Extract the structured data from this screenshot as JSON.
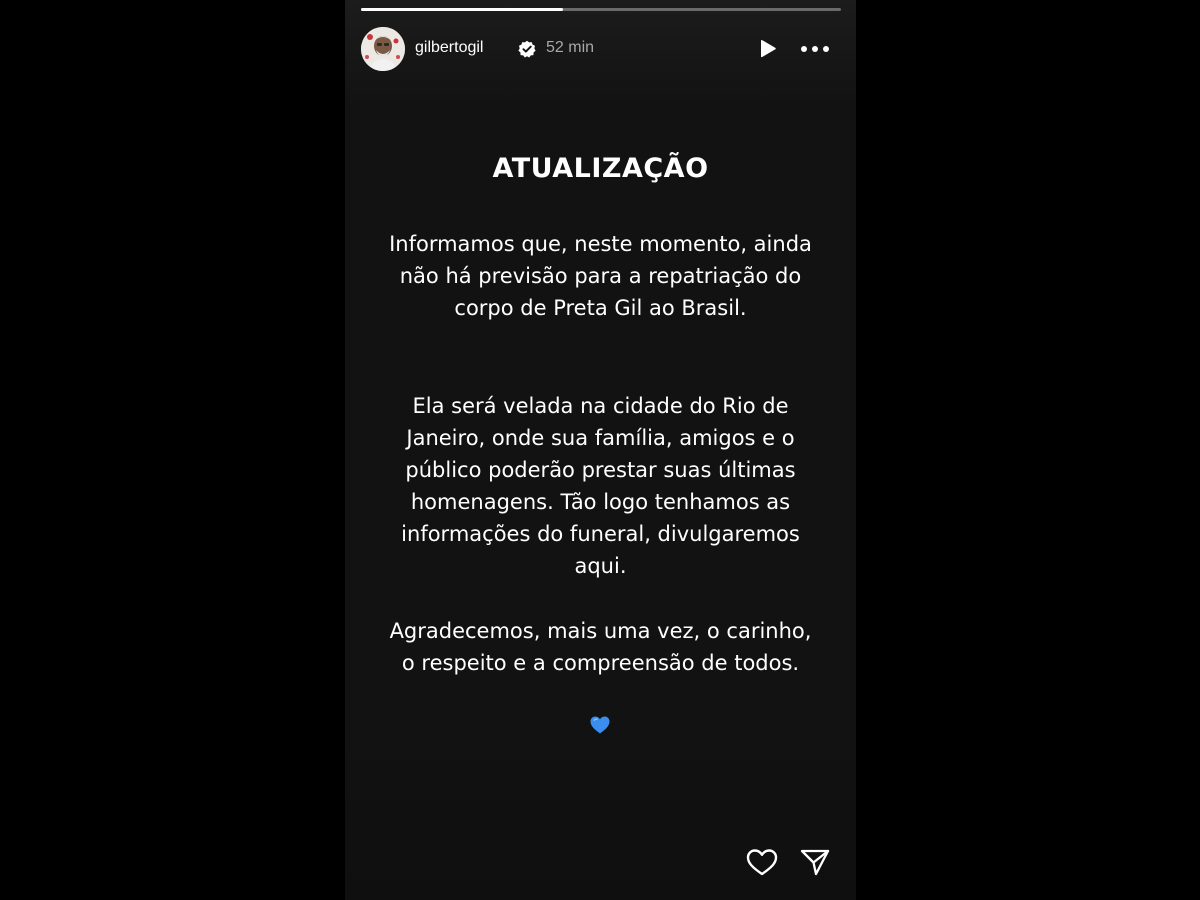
{
  "story": {
    "progress": 0.42,
    "user": {
      "username": "gilbertogil",
      "verified": true,
      "time_ago": "52 min"
    },
    "controls": {
      "play_icon": "play-icon",
      "more_icon": "more-horizontal-icon"
    },
    "post": {
      "title": "ATUALIZAÇÃO",
      "paragraph_1": "Informamos que, neste momento, ainda não há previsão para a repatriação do corpo de Preta Gil ao Brasil.",
      "paragraph_2": "Ela será velada na cidade do Rio de Janeiro, onde sua família, amigos e o público poderão prestar suas últimas homenagens. Tão logo tenhamos as informações do funeral, divulgaremos aqui.",
      "paragraph_3": "Agradecemos, mais uma vez, o carinho, o respeito e a compreensão de todos.",
      "emoji": "blue-heart-emoji"
    },
    "footer": {
      "like_icon": "heart-outline-icon",
      "share_icon": "send-icon"
    }
  },
  "colors": {
    "background": "#000000",
    "story_background": "#121212",
    "text": "#ffffff",
    "timestamp": "#a8a8a8",
    "verified_badge": "#ffffff",
    "heart_emoji": "#3b8ef0"
  }
}
